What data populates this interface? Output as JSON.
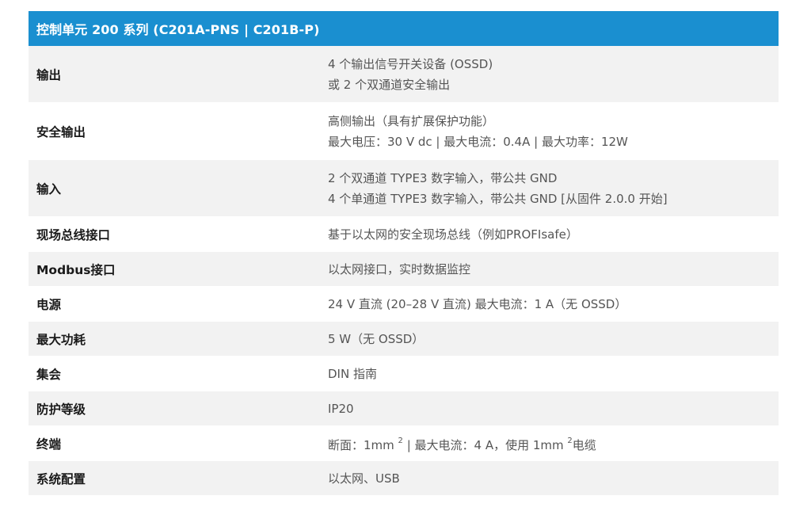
{
  "title": "控制单元 200 系列 (C201A-PNS | C201B-P)",
  "rows": [
    {
      "label": "输出",
      "lines": [
        "4 个输出信号开关设备 (OSSD)",
        "或 2 个双通道安全输出"
      ]
    },
    {
      "label": "安全输出",
      "lines": [
        "高侧输出（具有扩展保护功能）",
        "最大电压：30 V dc | 最大电流：0.4A | 最大功率：12W"
      ]
    },
    {
      "label": "输入",
      "lines": [
        "2 个双通道 TYPE3 数字输入，带公共 GND",
        "4 个单通道 TYPE3 数字输入，带公共 GND [从固件 2.0.0 开始]"
      ]
    },
    {
      "label": "现场总线接口",
      "lines": [
        "基于以太网的安全现场总线（例如PROFIsafe）"
      ]
    },
    {
      "label": "Modbus接口",
      "lines": [
        "以太网接口，实时数据监控"
      ]
    },
    {
      "label": "电源",
      "lines": [
        "24 V 直流 (20–28 V 直流) 最大电流：1 A（无 OSSD）"
      ]
    },
    {
      "label": "最大功耗",
      "lines": [
        "5 W（无 OSSD）"
      ]
    },
    {
      "label": "集会",
      "lines": [
        "DIN 指南"
      ]
    },
    {
      "label": "防护等级",
      "lines": [
        "IP20"
      ]
    },
    {
      "label": "终端",
      "terminal": {
        "part1": "断面：1mm ",
        "sup1": "2",
        "part2": " | 最大电流：4 A，使用 1mm ",
        "sup2": "2",
        "part3": "电缆"
      }
    },
    {
      "label": "系统配置",
      "lines": [
        "以太网、USB"
      ]
    }
  ]
}
